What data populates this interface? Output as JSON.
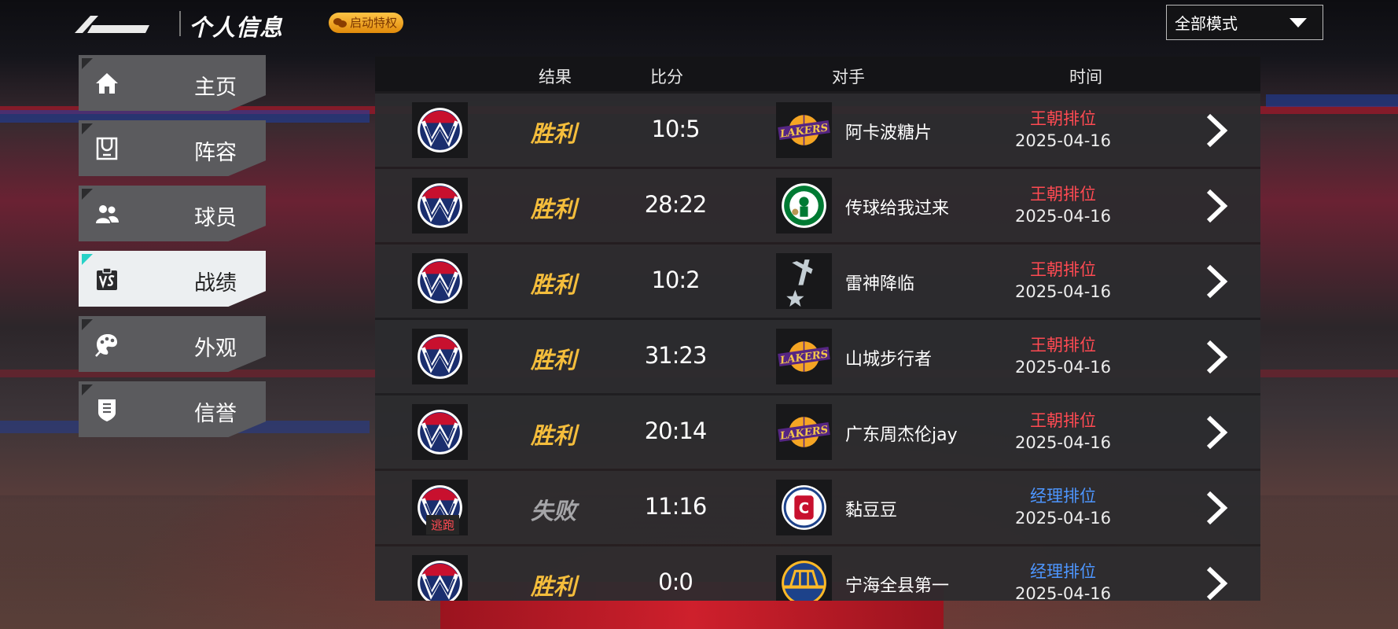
{
  "header": {
    "title": "个人信息",
    "privilege_label": "启动特权",
    "privilege_icon": "wechat-icon",
    "mode_select": "全部模式"
  },
  "sidebar": {
    "items": [
      {
        "label": "主页",
        "icon": "home-icon",
        "active": false
      },
      {
        "label": "阵容",
        "icon": "court-icon",
        "active": false
      },
      {
        "label": "球员",
        "icon": "players-icon",
        "active": false
      },
      {
        "label": "战绩",
        "icon": "vs-icon",
        "active": true
      },
      {
        "label": "外观",
        "icon": "palette-icon",
        "active": false
      },
      {
        "label": "信誉",
        "icon": "credit-shield-icon",
        "active": false
      }
    ]
  },
  "table": {
    "headers": {
      "result": "结果",
      "score": "比分",
      "opponent": "对手",
      "time": "时间"
    },
    "rows": [
      {
        "team_logo": "wizards-logo",
        "result": "胜利",
        "score": "10:5",
        "opponent_logo": "lakers-logo",
        "opponent": "阿卡波糖片",
        "mode": "王朝排位",
        "date": "2025-04-16"
      },
      {
        "team_logo": "wizards-logo",
        "result": "胜利",
        "score": "28:22",
        "opponent_logo": "celtics-logo",
        "opponent": "传球给我过来",
        "mode": "王朝排位",
        "date": "2025-04-16"
      },
      {
        "team_logo": "wizards-logo",
        "result": "胜利",
        "score": "10:2",
        "opponent_logo": "spurs-logo",
        "opponent": "雷神降临",
        "mode": "王朝排位",
        "date": "2025-04-16"
      },
      {
        "team_logo": "wizards-logo",
        "result": "胜利",
        "score": "31:23",
        "opponent_logo": "lakers-logo",
        "opponent": "山城步行者",
        "mode": "王朝排位",
        "date": "2025-04-16"
      },
      {
        "team_logo": "wizards-logo",
        "result": "胜利",
        "score": "20:14",
        "opponent_logo": "lakers-logo",
        "opponent": "广东周杰伦jay",
        "mode": "王朝排位",
        "date": "2025-04-16"
      },
      {
        "team_logo": "wizards-logo",
        "result": "失败",
        "score": "11:16",
        "opponent_logo": "clippers-logo",
        "opponent": "黏豆豆",
        "mode": "经理排位",
        "date": "2025-04-16",
        "tag": "逃跑"
      },
      {
        "team_logo": "wizards-logo",
        "result": "胜利",
        "score": "0:0",
        "opponent_logo": "warriors-logo",
        "opponent": "宁海全县第一",
        "mode": "经理排位",
        "date": "2025-04-16"
      }
    ]
  },
  "colors": {
    "win": "#f4bd3c",
    "loss": "#a5a5a8",
    "dynasty_mode": "#ff4a52",
    "manager_mode": "#4d96ff",
    "active_nav": "#eceff1",
    "accent_corner": "#27d2c7"
  }
}
